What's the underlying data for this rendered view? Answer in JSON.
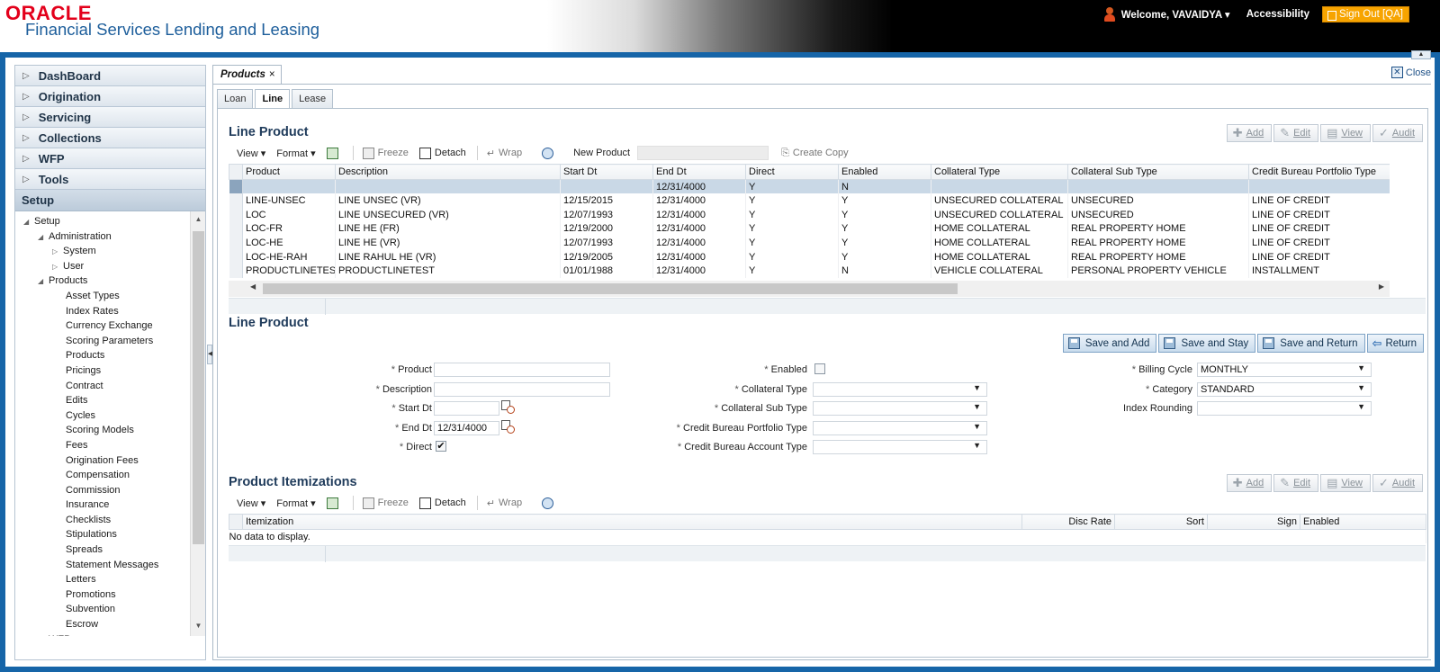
{
  "header": {
    "logo": "ORACLE",
    "product_name": "Financial Services Lending and Leasing",
    "welcome": "Welcome, VAVAIDYA ▾",
    "accessibility": "Accessibility",
    "signout": "Sign Out [QA]"
  },
  "sidebar": {
    "accordion": [
      "DashBoard",
      "Origination",
      "Servicing",
      "Collections",
      "WFP",
      "Tools"
    ],
    "setup_label": "Setup",
    "tree": [
      {
        "label": "Setup",
        "level": 0,
        "toggle": "◢"
      },
      {
        "label": "Administration",
        "level": 1,
        "toggle": "◢"
      },
      {
        "label": "System",
        "level": 2,
        "toggle": "▷"
      },
      {
        "label": "User",
        "level": 2,
        "toggle": "▷"
      },
      {
        "label": "Products",
        "level": 1,
        "toggle": "◢"
      },
      {
        "label": "Asset Types",
        "level": 3,
        "toggle": ""
      },
      {
        "label": "Index Rates",
        "level": 3,
        "toggle": ""
      },
      {
        "label": "Currency Exchange",
        "level": 3,
        "toggle": ""
      },
      {
        "label": "Scoring Parameters",
        "level": 3,
        "toggle": ""
      },
      {
        "label": "Products",
        "level": 3,
        "toggle": ""
      },
      {
        "label": "Pricings",
        "level": 3,
        "toggle": ""
      },
      {
        "label": "Contract",
        "level": 3,
        "toggle": ""
      },
      {
        "label": "Edits",
        "level": 3,
        "toggle": ""
      },
      {
        "label": "Cycles",
        "level": 3,
        "toggle": ""
      },
      {
        "label": "Scoring Models",
        "level": 3,
        "toggle": ""
      },
      {
        "label": "Fees",
        "level": 3,
        "toggle": ""
      },
      {
        "label": "Origination Fees",
        "level": 3,
        "toggle": ""
      },
      {
        "label": "Compensation",
        "level": 3,
        "toggle": ""
      },
      {
        "label": "Commission",
        "level": 3,
        "toggle": ""
      },
      {
        "label": "Insurance",
        "level": 3,
        "toggle": ""
      },
      {
        "label": "Checklists",
        "level": 3,
        "toggle": ""
      },
      {
        "label": "Stipulations",
        "level": 3,
        "toggle": ""
      },
      {
        "label": "Spreads",
        "level": 3,
        "toggle": ""
      },
      {
        "label": "Statement Messages",
        "level": 3,
        "toggle": ""
      },
      {
        "label": "Letters",
        "level": 3,
        "toggle": ""
      },
      {
        "label": "Promotions",
        "level": 3,
        "toggle": ""
      },
      {
        "label": "Subvention",
        "level": 3,
        "toggle": ""
      },
      {
        "label": "Escrow",
        "level": 3,
        "toggle": ""
      },
      {
        "label": "WFP",
        "level": 1,
        "toggle": "◢"
      }
    ]
  },
  "main": {
    "doc_tab": "Products",
    "close": "Close",
    "subtabs": [
      "Loan",
      "Line",
      "Lease"
    ],
    "active_subtab": "Line",
    "grid_section_title": "Line Product",
    "grid_buttons": {
      "add": "Add",
      "edit": "Edit",
      "view": "View",
      "audit": "Audit"
    },
    "toolbar": {
      "view": "View ▾",
      "format": "Format ▾",
      "freeze": "Freeze",
      "detach": "Detach",
      "wrap": "Wrap",
      "new_product": "New Product",
      "create_copy": "Create Copy"
    },
    "grid_columns": [
      "Product",
      "Description",
      "Start Dt",
      "End Dt",
      "Direct",
      "Enabled",
      "Collateral Type",
      "Collateral Sub Type",
      "Credit Bureau Portfolio Type"
    ],
    "grid_rows": [
      [
        "",
        "",
        "",
        "12/31/4000",
        "Y",
        "N",
        "",
        "",
        ""
      ],
      [
        "LINE-UNSEC",
        "LINE UNSEC (VR)",
        "12/15/2015",
        "12/31/4000",
        "Y",
        "Y",
        "UNSECURED COLLATERAL",
        "UNSECURED",
        "LINE OF CREDIT"
      ],
      [
        "LOC",
        "LINE UNSECURED (VR)",
        "12/07/1993",
        "12/31/4000",
        "Y",
        "Y",
        "UNSECURED COLLATERAL",
        "UNSECURED",
        "LINE OF CREDIT"
      ],
      [
        "LOC-FR",
        "LINE HE (FR)",
        "12/19/2000",
        "12/31/4000",
        "Y",
        "Y",
        "HOME COLLATERAL",
        "REAL PROPERTY HOME",
        "LINE OF CREDIT"
      ],
      [
        "LOC-HE",
        "LINE HE (VR)",
        "12/07/1993",
        "12/31/4000",
        "Y",
        "Y",
        "HOME COLLATERAL",
        "REAL PROPERTY HOME",
        "LINE OF CREDIT"
      ],
      [
        "LOC-HE-RAH",
        "LINE RAHUL HE (VR)",
        "12/19/2005",
        "12/31/4000",
        "Y",
        "Y",
        "HOME COLLATERAL",
        "REAL PROPERTY HOME",
        "LINE OF CREDIT"
      ],
      [
        "PRODUCTLINETEST",
        "PRODUCTLINETEST",
        "01/01/1988",
        "12/31/4000",
        "Y",
        "N",
        "VEHICLE COLLATERAL",
        "PERSONAL PROPERTY VEHICLE",
        "INSTALLMENT"
      ]
    ],
    "form_section_title": "Line Product",
    "form_buttons": {
      "save_add": "Save and Add",
      "save_stay": "Save and Stay",
      "save_return": "Save and Return",
      "return": "Return"
    },
    "form": {
      "product_label": "Product",
      "description_label": "Description",
      "start_dt_label": "Start Dt",
      "end_dt_label": "End Dt",
      "end_dt_value": "12/31/4000",
      "direct_label": "Direct",
      "direct_checked": "✔",
      "enabled_label": "Enabled",
      "collateral_type_label": "Collateral Type",
      "collateral_sub_type_label": "Collateral Sub Type",
      "cb_portfolio_label": "Credit Bureau Portfolio Type",
      "cb_account_label": "Credit Bureau Account Type",
      "billing_cycle_label": "Billing Cycle",
      "billing_cycle_value": "MONTHLY",
      "category_label": "Category",
      "category_value": "STANDARD",
      "index_rounding_label": "Index Rounding",
      "index_rounding_value": ""
    },
    "items_section_title": "Product Itemizations",
    "items_columns": [
      "Itemization",
      "Disc Rate",
      "Sort",
      "Sign",
      "Enabled"
    ],
    "items_empty": "No data to display."
  }
}
